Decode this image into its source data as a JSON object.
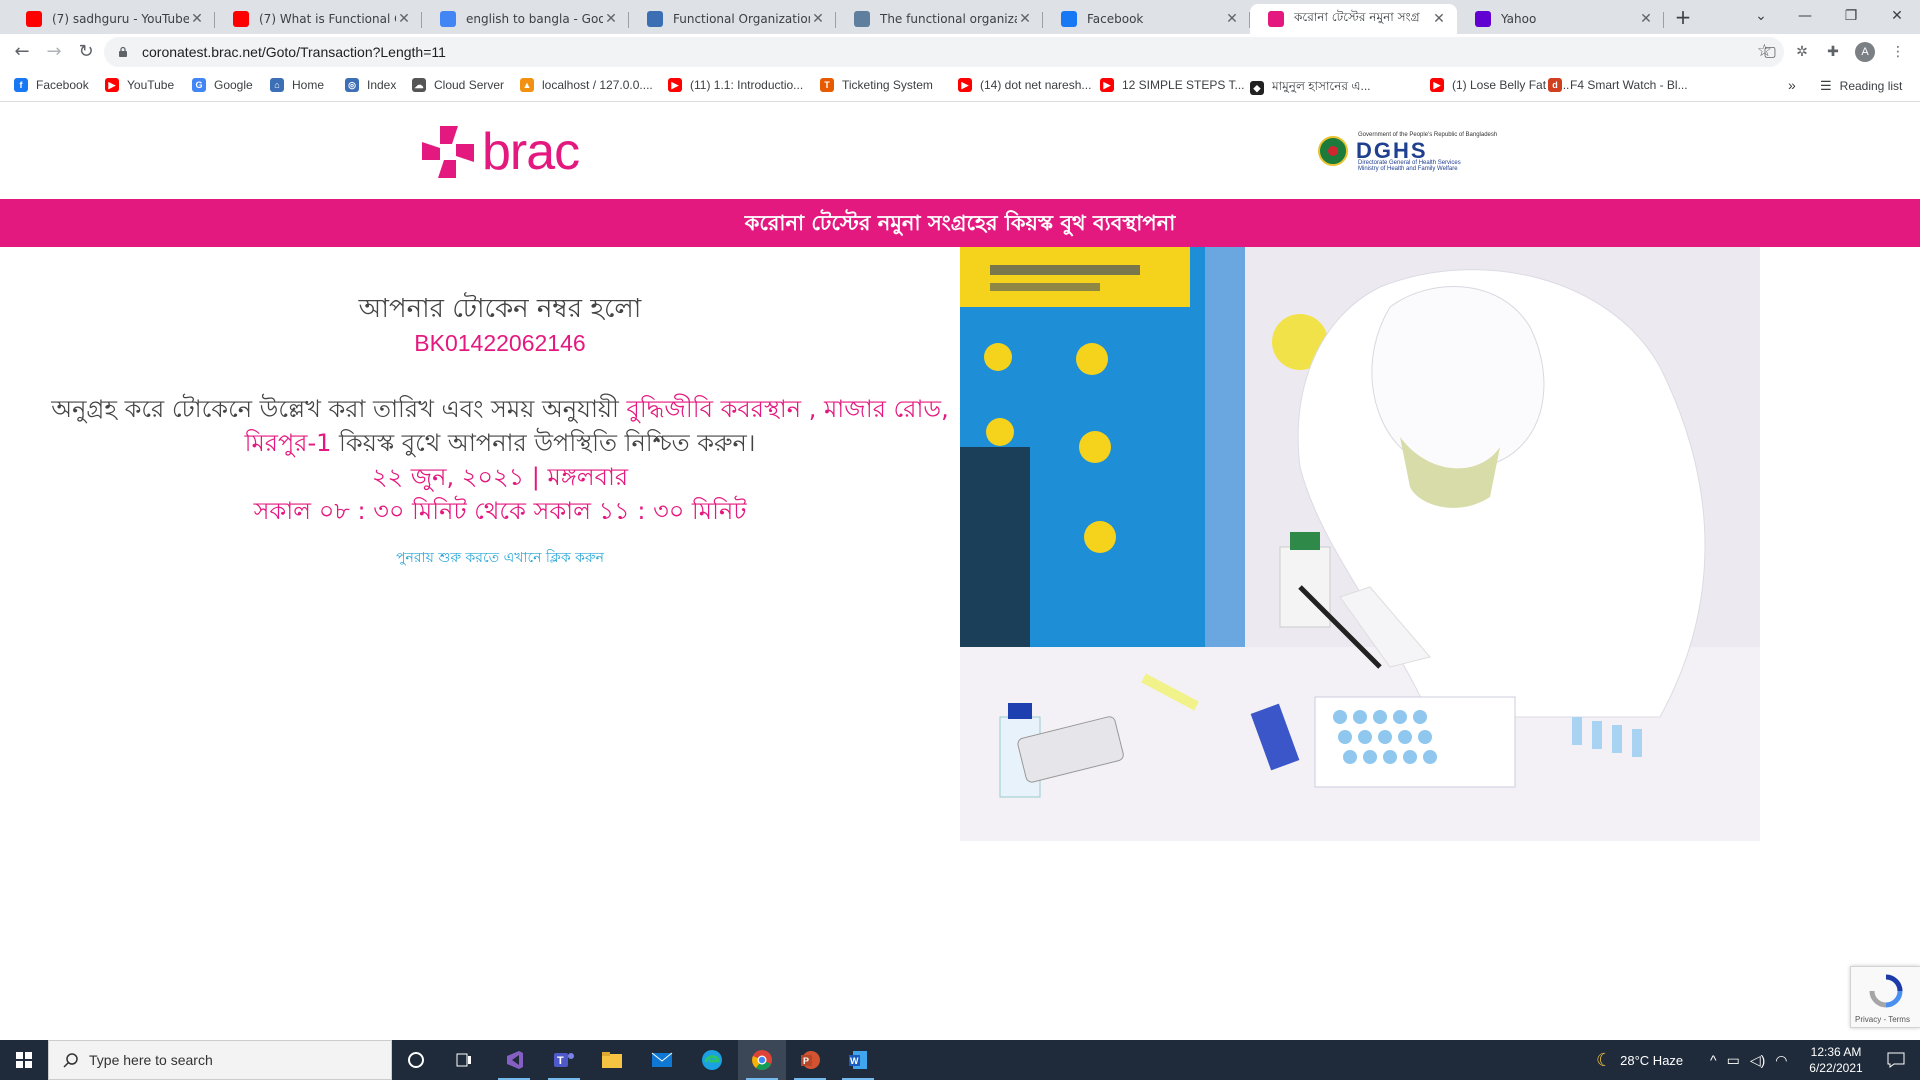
{
  "browser": {
    "tabs": [
      {
        "title": "(7) sadhguru - YouTube",
        "icon": "youtube-icon",
        "color": "#ff0000"
      },
      {
        "title": "(7) What is Functional Orga",
        "icon": "youtube-icon",
        "color": "#ff0000"
      },
      {
        "title": "english to bangla - Google",
        "icon": "google-icon",
        "color": "#4285f4"
      },
      {
        "title": "Functional Organizational",
        "icon": "page-icon",
        "color": "#3c6eb4"
      },
      {
        "title": "The functional organizatio",
        "icon": "page-icon",
        "color": "#5f7f9f"
      },
      {
        "title": "Facebook",
        "icon": "facebook-icon",
        "color": "#1877f2"
      },
      {
        "title": "করোনা টেস্টের নমুনা সংগ্র",
        "icon": "brac-icon",
        "color": "#e4197f"
      },
      {
        "title": "Yahoo",
        "icon": "yahoo-icon",
        "color": "#6001d2"
      }
    ],
    "url": "coronatest.brac.net/Goto/Transaction?Length=11",
    "profile_initial": "A",
    "bookmarks": [
      {
        "title": "Facebook",
        "color": "#1877f2",
        "glyph": "f"
      },
      {
        "title": "YouTube",
        "color": "#ff0000",
        "glyph": "▶"
      },
      {
        "title": "Google",
        "color": "#4285f4",
        "glyph": "G"
      },
      {
        "title": "Home",
        "color": "#3d6fb6",
        "glyph": "⌂"
      },
      {
        "title": "Index",
        "color": "#3d6fb6",
        "glyph": "◎"
      },
      {
        "title": "Cloud Server",
        "color": "#555555",
        "glyph": "☁"
      },
      {
        "title": "localhost / 127.0.0....",
        "color": "#f29111",
        "glyph": "▲"
      },
      {
        "title": "(11) 1.1: Introductio...",
        "color": "#ff0000",
        "glyph": "▶"
      },
      {
        "title": "Ticketing System",
        "color": "#e65a00",
        "glyph": "T"
      },
      {
        "title": "(14) dot net naresh...",
        "color": "#ff0000",
        "glyph": "▶"
      },
      {
        "title": "12 SIMPLE STEPS T...",
        "color": "#ff0000",
        "glyph": "▶"
      },
      {
        "title": "মামুনুল হাসানের এ...",
        "color": "#222222",
        "glyph": "◆"
      },
      {
        "title": "(1) Lose Belly Fat In...",
        "color": "#ff0000",
        "glyph": "▶"
      },
      {
        "title": "F4 Smart Watch - Bl...",
        "color": "#d04020",
        "glyph": "d"
      }
    ],
    "more_bookmarks": "»",
    "reading_list": "Reading list"
  },
  "page": {
    "brand": "brac",
    "dghs": {
      "gov_line": "Government of the People's Republic of Bangladesh",
      "abbr": "DGHS",
      "full_name": "Directorate General of Health Services",
      "ministry": "Ministry of Health and Family Welfare"
    },
    "banner": "করোনা টেস্টের নমুনা সংগ্রহের কিয়স্ক বুথ ব্যবস্থাপনা",
    "token_label": "আপনার টোকেন নম্বর হলো",
    "token_number": "BK01422062146",
    "instruction_prefix": "অনুগ্রহ করে টোকেনে উল্লেখ করা তারিখ এবং সময় অনুযায়ী",
    "location": "বুদ্ধিজীবি কবরস্থান , মাজার রোড, মিরপুর-1",
    "instruction_suffix": "কিয়স্ক বুথে আপনার উপস্থিতি নিশ্চিত করুন।",
    "date": "২২ জুন, ২০২১ | মঙ্গলবার",
    "time": "সকাল ০৮ : ৩০ মিনিট থেকে সকাল ১১ : ৩০ মিনিট",
    "restart_link": "পুনরায় শুরু করতে এখানে ক্লিক করুন",
    "recaptcha": "Privacy - Terms"
  },
  "taskbar": {
    "search_placeholder": "Type here to search",
    "weather": "28°C  Haze",
    "time": "12:36 AM",
    "date": "6/22/2021"
  }
}
